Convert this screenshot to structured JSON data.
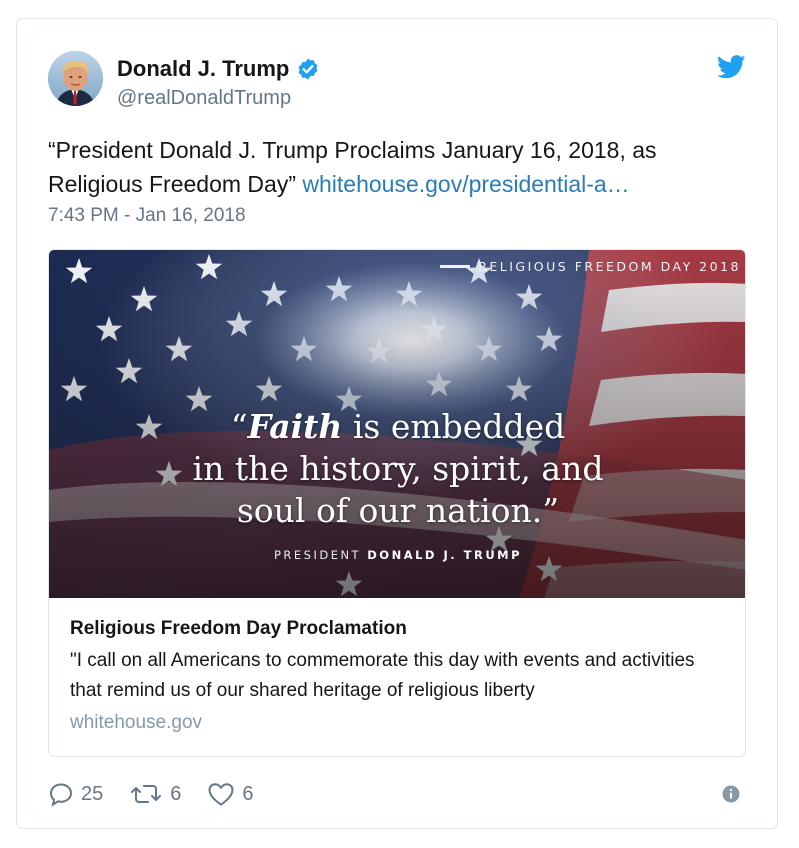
{
  "author": {
    "name": "Donald J. Trump",
    "handle": "@realDonaldTrump",
    "verified": true
  },
  "icons": {
    "platform": "twitter-bird-icon",
    "verified": "verified-badge-icon",
    "reply": "reply-icon",
    "retweet": "retweet-icon",
    "like": "heart-icon",
    "info": "info-icon"
  },
  "tweet": {
    "text": "“President Donald J. Trump Proclaims January 16, 2018, as Religious Freedom Day”",
    "link_text": "whitehouse.gov/presidential-a…",
    "timestamp": "7:43 PM - Jan 16, 2018"
  },
  "card": {
    "image": {
      "tag": "RELIGIOUS FREEDOM DAY 2018",
      "quote_open": "“",
      "quote_emphasis": "Faith",
      "quote_rest_1": " is embedded",
      "quote_line_2": "in the history, spirit, and",
      "quote_line_3": "soul of our nation.”",
      "attribution_prefix": "PRESIDENT",
      "attribution_name": "DONALD J. TRUMP"
    },
    "title": "Religious Freedom Day Proclamation",
    "description": "\"I call on all Americans to commemorate this day with events and activities that remind us of our shared heritage of religious liberty",
    "domain": "whitehouse.gov"
  },
  "actions": {
    "replies": "25",
    "retweets": "6",
    "likes": "6"
  },
  "colors": {
    "link": "#2b7bb9",
    "twitter_blue": "#1da1f2",
    "muted": "#657786",
    "border": "#e1e8ed",
    "text": "#14171a"
  }
}
